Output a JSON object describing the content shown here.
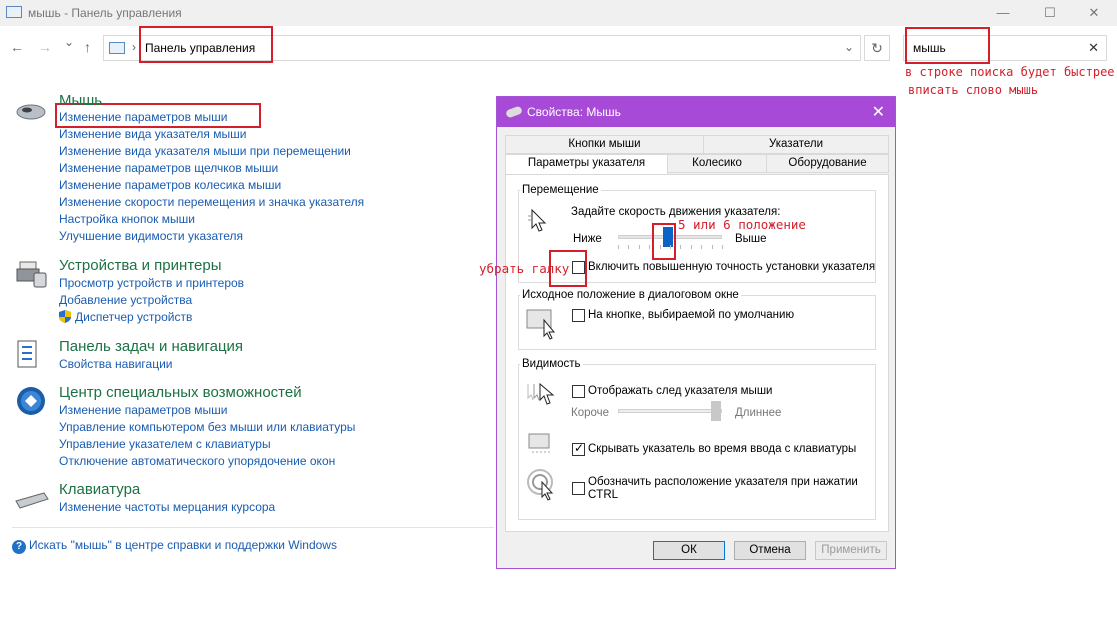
{
  "window": {
    "title": "мышь - Панель управления",
    "minimize": "—",
    "maximize": "☐",
    "close": "✕"
  },
  "nav": {
    "back": "←",
    "forward": "→",
    "recent": "⌄",
    "up": "↑",
    "separator": "›",
    "address": "Панель управления",
    "dropdown": "⌄",
    "refresh": "↻",
    "search_value": "мышь",
    "search_clear": "✕"
  },
  "annotations": {
    "search_note_line1": "в строке поиска будет быстрее",
    "search_note_line2": "вписать слово мышь",
    "speed_note": "5 или 6 положение",
    "checkbox_note": "убрать галку"
  },
  "control_panel": {
    "groups": [
      {
        "icon": "mouse-icon",
        "title": "Мышь",
        "links": [
          "Изменение параметров мыши",
          "Изменение вида указателя мыши",
          "Изменение вида указателя мыши при перемещении",
          "Изменение параметров щелчков мыши",
          "Изменение параметров колесика мыши",
          "Изменение скорости перемещения и значка указателя",
          "Настройка кнопок мыши",
          "Улучшение видимости указателя"
        ]
      },
      {
        "icon": "printer-icon",
        "title": "Устройства и принтеры",
        "links": [
          "Просмотр устройств и принтеров",
          "Добавление устройства",
          "Диспетчер устройств"
        ]
      },
      {
        "icon": "taskbar-icon",
        "title": "Панель задач и навигация",
        "links": [
          "Свойства навигации"
        ]
      },
      {
        "icon": "accessibility-icon",
        "title": "Центр специальных возможностей",
        "links": [
          "Изменение параметров мыши",
          "Управление компьютером без мыши или клавиатуры",
          "Управление указателем с клавиатуры",
          "Отключение автоматического упорядочение окон"
        ]
      },
      {
        "icon": "keyboard-icon",
        "title": "Клавиатура",
        "links": [
          "Изменение частоты мерцания курсора"
        ]
      }
    ],
    "help_link": "Искать \"мышь\" в центре справки и поддержки Windows"
  },
  "dialog": {
    "title": "Свойства: Мышь",
    "close": "✕",
    "tabs_row1": [
      "Кнопки мыши",
      "Указатели"
    ],
    "tabs_row2": [
      "Параметры указателя",
      "Колесико",
      "Оборудование"
    ],
    "active_tab": "Параметры указателя",
    "movement": {
      "group_label": "Перемещение",
      "speed_label": "Задайте скорость движения указателя:",
      "slow": "Ниже",
      "fast": "Выше",
      "speed_value": 5,
      "speed_max": 11,
      "precision_label": "Включить повышенную точность установки указателя",
      "precision_checked": false
    },
    "snap_to": {
      "group_label": "Исходное положение в диалоговом окне",
      "label": "На кнопке, выбираемой по умолчанию",
      "checked": false
    },
    "visibility": {
      "group_label": "Видимость",
      "trails_label": "Отображать след указателя мыши",
      "trails_checked": false,
      "short": "Короче",
      "long": "Длиннее",
      "hide_label": "Скрывать указатель во время ввода с клавиатуры",
      "hide_checked": true,
      "ctrl_label_line1": "Обозначить расположение указателя при нажатии",
      "ctrl_label_line2": "CTRL",
      "ctrl_checked": false
    },
    "buttons": {
      "ok": "ОК",
      "cancel": "Отмена",
      "apply": "Применить"
    }
  },
  "colors": {
    "accent_purple": "#a84ad8",
    "link_blue": "#1a5cb0",
    "group_green": "#1e7145",
    "annotation_red": "#d31f2b"
  }
}
